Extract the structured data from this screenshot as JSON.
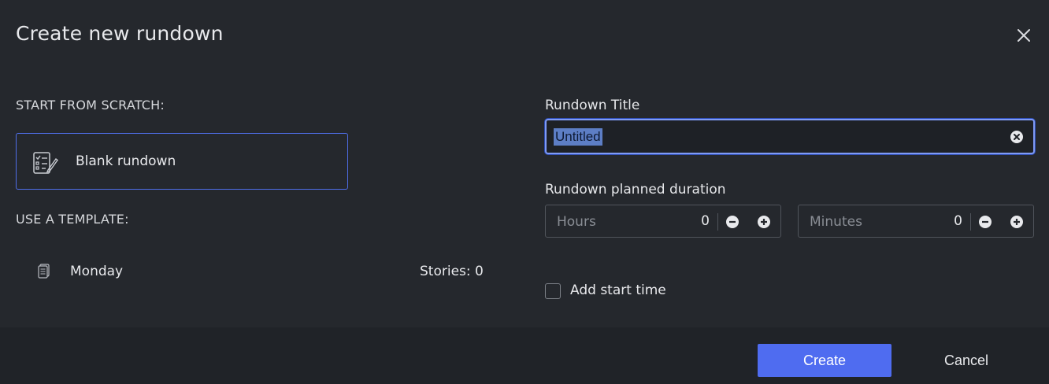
{
  "dialog": {
    "title": "Create new rundown",
    "close_icon": "close-icon"
  },
  "left": {
    "scratch_label": "START FROM SCRATCH:",
    "blank_card": {
      "label": "Blank rundown",
      "icon": "checklist-edit-icon"
    },
    "template_label": "USE A TEMPLATE:",
    "templates": [
      {
        "name": "Monday",
        "stories": "Stories: 0",
        "icon": "document-icon"
      }
    ]
  },
  "right": {
    "title_label": "Rundown Title",
    "title_value": "Untitled",
    "clear_icon": "clear-circle-icon",
    "duration_label": "Rundown planned duration",
    "hours": {
      "placeholder": "Hours",
      "value": "0"
    },
    "minutes": {
      "placeholder": "Minutes",
      "value": "0"
    },
    "start_time_label": "Add start time",
    "start_time_checked": false
  },
  "footer": {
    "create_label": "Create",
    "cancel_label": "Cancel"
  },
  "colors": {
    "accent": "#4f6cf0",
    "background": "#25282d",
    "footer": "#202328"
  }
}
